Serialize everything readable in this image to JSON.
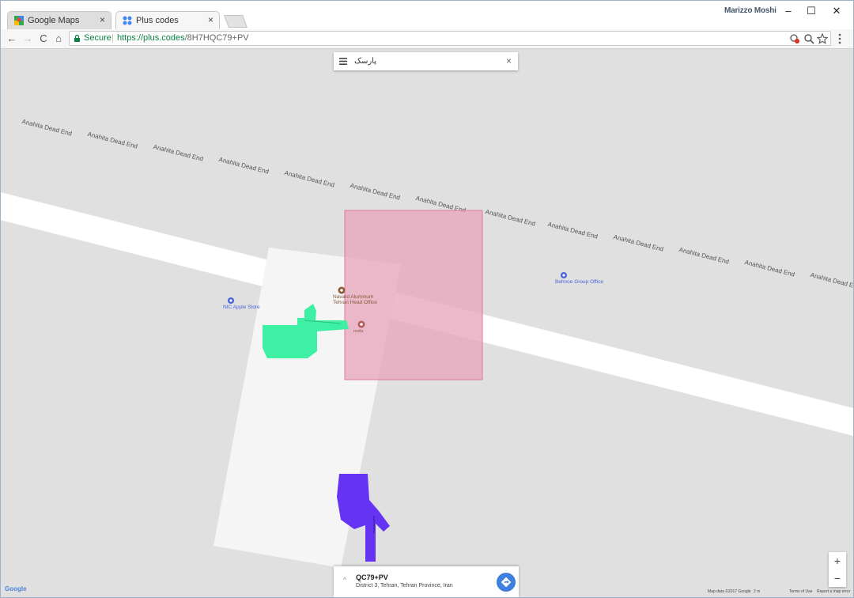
{
  "browser": {
    "tabs": [
      {
        "title": "Google Maps",
        "close": "×"
      },
      {
        "title": "Plus codes",
        "close": "×"
      }
    ],
    "profile_name": "Marizzo Moshi",
    "window_controls": {
      "minimize": "–",
      "maximize": "☐",
      "close": "✕"
    },
    "nav": {
      "back": "←",
      "forward": "→",
      "reload": "C",
      "home": "⌂"
    },
    "address": {
      "secure_label": "Secure",
      "separator": "|",
      "url_host": "https://plus.codes",
      "url_path": "/8H7HQC79+PV"
    },
    "icons": [
      "back-arrow-icon",
      "forward-arrow-icon",
      "reload-icon",
      "home-icon",
      "lock-icon",
      "location-blocked-icon",
      "zoom-icon",
      "star-icon",
      "menu-dots-icon"
    ]
  },
  "map": {
    "search": {
      "query": "پارسک",
      "clear": "×"
    },
    "road_label": "Anahita Dead End",
    "pois": [
      {
        "name_line1": "Navard Aluminum",
        "name_line2": "Tehran Head Office",
        "color": "#8a5a3c"
      },
      {
        "name": "NIC Apple Store",
        "color": "#4a64d8"
      },
      {
        "name": "Behnoe Group Office",
        "color": "#4a64d8"
      },
      {
        "name": "rozita",
        "color": "#8a5a3c"
      }
    ],
    "plus_code_area_color": "#e8a7bd",
    "building_color": "#f5f5f5",
    "annotations": [
      "green-pointing-hand-icon",
      "purple-pointing-hand-icon"
    ],
    "bottom_card": {
      "code": "QC79+PV",
      "address": "District 3, Tehran, Tehran Province, Iran",
      "chevron": "^"
    },
    "zoom": {
      "in": "+",
      "out": "−"
    },
    "logo": "Google",
    "attribution": {
      "data": "Map data ©2017 Google",
      "scale": "2 m",
      "terms": "Terms of Use",
      "report": "Report a map error"
    }
  }
}
